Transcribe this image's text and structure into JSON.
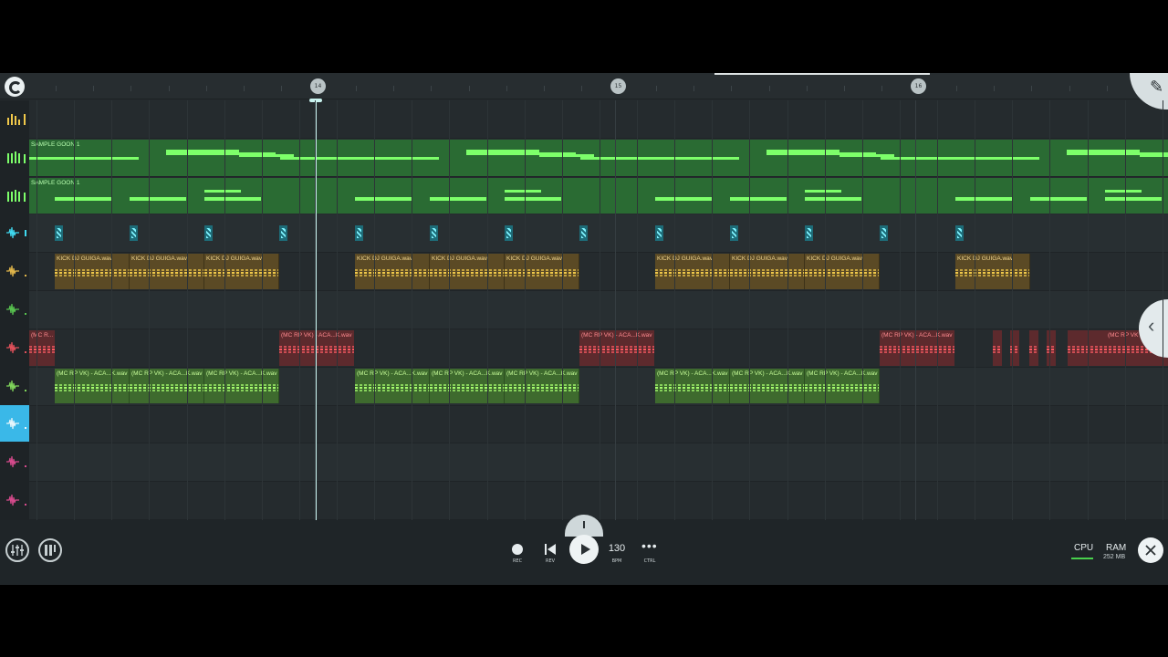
{
  "ruler": {
    "markers": [
      "14",
      "15",
      "16"
    ]
  },
  "tracks": [
    {
      "icon": "meter-icon",
      "color": "#f0c84a"
    },
    {
      "icon": "pattern-icon",
      "color": "#7dff6a"
    },
    {
      "icon": "pattern-icon",
      "color": "#7dff6a"
    },
    {
      "icon": "waveform-icon",
      "color": "#3fd9f0"
    },
    {
      "icon": "waveform-icon",
      "color": "#e0b54a"
    },
    {
      "icon": "waveform-icon",
      "color": "#58c24f"
    },
    {
      "icon": "waveform-icon",
      "color": "#e0505a"
    },
    {
      "icon": "waveform-icon",
      "color": "#7fd45a"
    },
    {
      "icon": "waveform-icon",
      "color": "#ffffff"
    },
    {
      "icon": "waveform-icon",
      "color": "#d64a8c"
    },
    {
      "icon": "waveform-icon",
      "color": "#d64a8c"
    }
  ],
  "clips": {
    "pattern_label": "SAMPLE GOON 1",
    "kick_label": "KICK DJ GUIGA.wav",
    "red_label": "(MC RP VK) - ACA...K.wav",
    "red_label_short": "(MC R...",
    "red_label_tail": "(MC RP VK",
    "green_label": "(MC RP VK) - ACA...K.wav"
  },
  "transport": {
    "rec_label": "REC",
    "rev_label": "REV",
    "bpm_value": "130",
    "bpm_label": "BPM",
    "ctrl_label": "CTRL"
  },
  "status": {
    "cpu_label": "CPU",
    "ram_label": "RAM",
    "ram_value": "252 MB"
  },
  "colors": {
    "accent": "#3ab8e8",
    "pattern": "#7dff6a",
    "kick": "#5b4a25",
    "red": "#5d2a2d",
    "green": "#3e6a2e"
  }
}
